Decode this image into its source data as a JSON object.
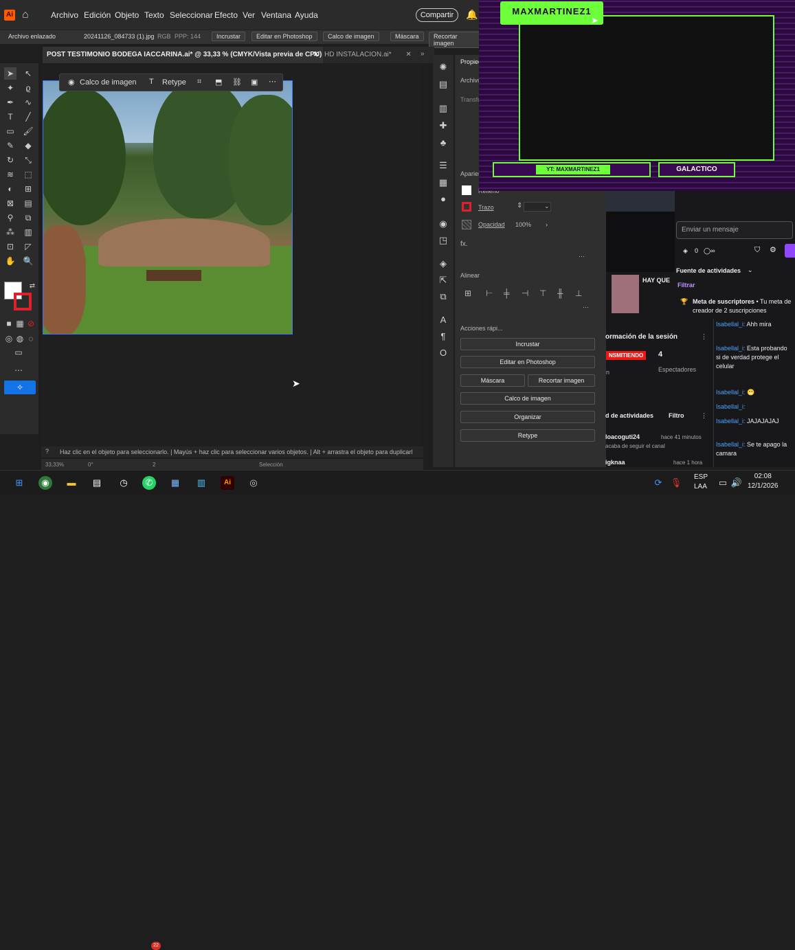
{
  "menubar": {
    "app_logo": "Ai",
    "items": [
      "Archivo",
      "Edición",
      "Objeto",
      "Texto",
      "Seleccionar",
      "Efecto",
      "Ver",
      "Ventana",
      "Ayuda"
    ],
    "share_label": "Compartir"
  },
  "control_bar": {
    "linked_file": "Archivo enlazado",
    "file_name": "20241126_084733 (1).jpg",
    "color_mode": "RGB",
    "ppi": "PPP: 144",
    "embed": "Incrustar",
    "edit_photoshop": "Editar en Photoshop",
    "image_trace": "Calco de imagen",
    "mask": "Máscara",
    "crop": "Recortar imagen"
  },
  "tabs": [
    {
      "label": "POST TESTIMONIO BODEGA IACCARINA.ai* @ 33,33 % (CMYK/Vista previa de CPU)"
    },
    {
      "label": "HD INSTALACION.ai*"
    }
  ],
  "float_bar": {
    "trace_label": "Calco de imagen",
    "retype_label": "Retype"
  },
  "status": {
    "text": "Haz clic en el objeto para seleccionarlo. | Mayús + haz clic para seleccionar varios objetos. | Alt + arrastra el objeto para duplicarl",
    "zoom": "33,33%",
    "angle": "0°",
    "artboard": "2",
    "mode": "Selección"
  },
  "properties": {
    "title": "Propiedades",
    "linked": "Archivo",
    "transform": "Transformar",
    "appearance": "Apariencia",
    "fill": "Relleno",
    "stroke": "Trazo",
    "opacity_label": "Opacidad",
    "opacity_value": "100%",
    "fx": "fx.",
    "align": "Alinear",
    "quick_actions": "Acciones rápi...",
    "buttons": [
      "Incrustar",
      "Editar en Photoshop",
      "Máscara",
      "Recortar imagen",
      "Calco de imagen",
      "Organizar",
      "Retype"
    ]
  },
  "overlay": {
    "brand": "MAXMARTINEZ1",
    "yt": "YT: MAXMARTINEZ1",
    "galactico": "GALACTICO",
    "colors": {
      "neon": "#6dff3a",
      "purple": "#3a0a50"
    }
  },
  "chat": {
    "placeholder": "Enviar un mensaje",
    "points": "0",
    "feed_title": "Fuente de actividades",
    "filter": "Filtrar",
    "goal_title": "Meta de suscriptores",
    "goal_text": "• Tu meta de creador de 2 suscripciones",
    "hay_que": "HAY QUE",
    "session_title": "ormación de la sesión",
    "live_badge": "NSMITIENDO",
    "viewers_count": "4",
    "viewers_label": "Espectadores",
    "n_label": "n",
    "activity_title": "d de actividades",
    "activity_filter": "Filtro",
    "events": [
      {
        "user": "loacoguti24",
        "time": "hace 41 minutos",
        "text": "acaba de seguir el canal"
      },
      {
        "user": "igknaa",
        "time": "hace 1 hora",
        "text": ""
      }
    ],
    "messages": [
      {
        "user": "Isabellal_i:",
        "text": "Ahh mira"
      },
      {
        "user": "Isabellal_i:",
        "text": "Esta probando si de verdad protege el celular"
      },
      {
        "user": "Isabellal_i:",
        "text": "😁"
      },
      {
        "user": "Isabellal_i:",
        "text": ""
      },
      {
        "user": "Isabellal_i:",
        "text": "JAJAJAJAJ"
      },
      {
        "user": "Isabellal_i:",
        "text": "Se te apago la camara"
      }
    ]
  },
  "taskbar": {
    "lang": "ESP",
    "region": "LAA",
    "time": "02:08",
    "date": "12/1/2026",
    "badge": "22"
  }
}
